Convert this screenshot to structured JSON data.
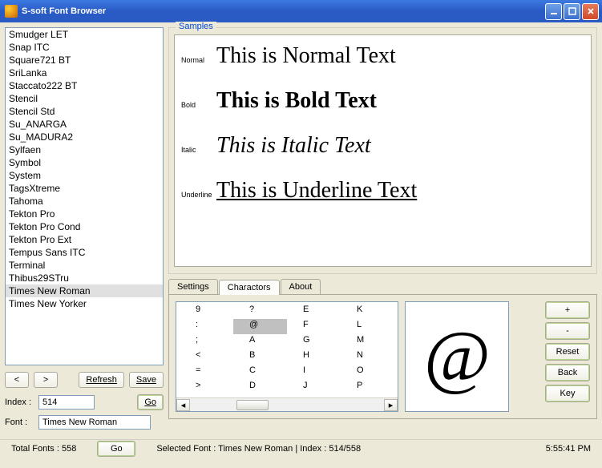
{
  "window": {
    "title": "S-soft Font Browser"
  },
  "fonts": [
    "Smudger LET",
    "Snap ITC",
    "Square721 BT",
    "SriLanka",
    "Staccato222 BT",
    "Stencil",
    "Stencil Std",
    "Su_ANARGA",
    "Su_MADURA2",
    "Sylfaen",
    "Symbol",
    "System",
    "TagsXtreme",
    "Tahoma",
    "Tekton Pro",
    "Tekton Pro Cond",
    "Tekton Pro Ext",
    "Tempus Sans ITC",
    "Terminal",
    "Thibus29STru",
    "Times New Roman",
    "Times New Yorker"
  ],
  "selected_font_index": 20,
  "nav": {
    "prev": "<",
    "next": ">",
    "refresh": "Refresh",
    "save": "Save",
    "go": "Go"
  },
  "form": {
    "index_label": "Index :",
    "index_value": "514",
    "font_label": "Font :",
    "font_value": "Times New Roman"
  },
  "samples": {
    "group_label": "Samples",
    "rows": [
      {
        "tag": "Normal",
        "text": "This is Normal Text",
        "cls": ""
      },
      {
        "tag": "Bold",
        "text": "This is Bold Text",
        "cls": "bold"
      },
      {
        "tag": "Italic",
        "text": "This is Italic Text",
        "cls": "italic"
      },
      {
        "tag": "Underline",
        "text": "This is Underline Text",
        "cls": "underline"
      }
    ]
  },
  "tabs": {
    "items": [
      "Settings",
      "Charactors",
      "About"
    ],
    "active": 1
  },
  "chars": {
    "grid": [
      "9",
      "?",
      "E",
      "K",
      ":",
      "@",
      "F",
      "L",
      ";",
      "A",
      "G",
      "M",
      "<",
      "B",
      "H",
      "N",
      "=",
      "C",
      "I",
      "O",
      ">",
      "D",
      "J",
      "P"
    ],
    "selected": "@",
    "preview": "@"
  },
  "charbtns": {
    "plus": "+",
    "minus": "-",
    "reset": "Reset",
    "back": "Back",
    "key": "Key"
  },
  "status": {
    "total": "Total Fonts : 558",
    "go": "Go",
    "selected": "Selected Font : Times New Roman  |  Index : 514/558",
    "time": "5:55:41 PM"
  }
}
